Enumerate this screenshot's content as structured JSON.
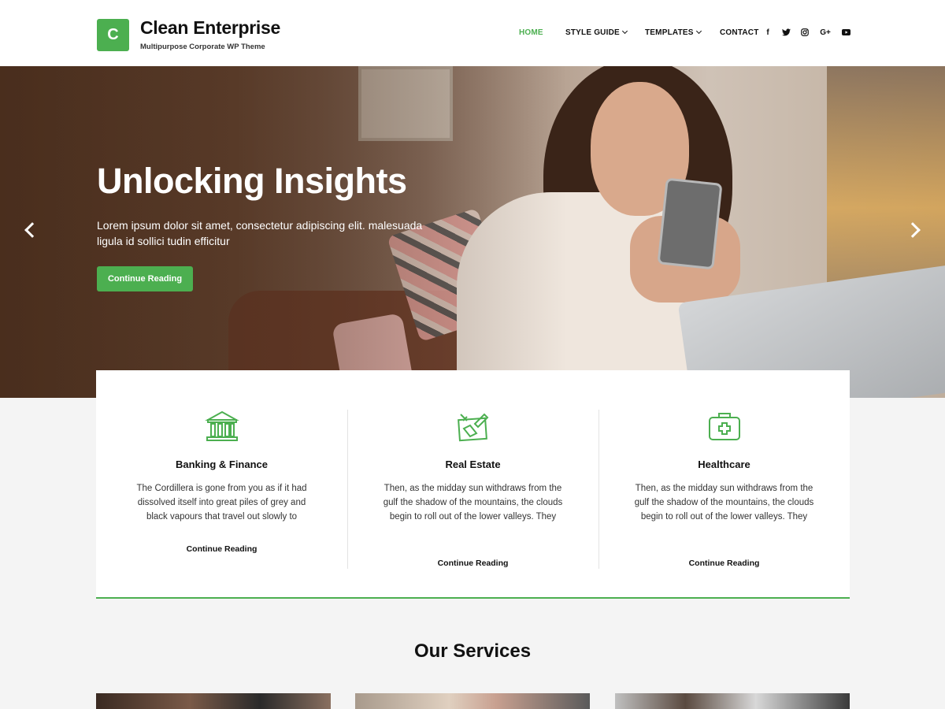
{
  "header": {
    "logo_letter": "C",
    "site_title": "Clean Enterprise",
    "tagline": "Multipurpose Corporate WP Theme",
    "nav": [
      {
        "label": "HOME",
        "active": true
      },
      {
        "label": "STYLE GUIDE",
        "dropdown": true
      },
      {
        "label": "TEMPLATES",
        "dropdown": true
      },
      {
        "label": "CONTACT"
      }
    ],
    "social": [
      {
        "icon": "facebook-icon",
        "glyph": "f"
      },
      {
        "icon": "twitter-icon",
        "glyph": "t"
      },
      {
        "icon": "instagram-icon",
        "glyph": "◎"
      },
      {
        "icon": "google-plus-icon",
        "glyph": "G+"
      },
      {
        "icon": "youtube-icon",
        "glyph": "▶"
      }
    ]
  },
  "hero": {
    "title": "Unlocking Insights",
    "text": "Lorem ipsum dolor sit amet, consectetur adipiscing elit. malesuada ligula id sollici tudin efficitur",
    "button": "Continue Reading"
  },
  "features": [
    {
      "icon": "bank-icon",
      "title": "Banking & Finance",
      "text": "The Cordillera is gone from you as if it had dissolved itself into great piles of grey and black vapours that travel out slowly to",
      "link": "Continue Reading"
    },
    {
      "icon": "real-estate-icon",
      "title": "Real Estate",
      "text": "Then, as the midday sun withdraws from the gulf the shadow of the mountains, the clouds begin to roll out of the lower valleys. They",
      "link": "Continue Reading"
    },
    {
      "icon": "medical-kit-icon",
      "title": "Healthcare",
      "text": "Then, as the midday sun withdraws from the gulf the shadow of the mountains, the clouds begin to roll out of the lower valleys. They",
      "link": "Continue Reading"
    }
  ],
  "services": {
    "title": "Our Services"
  },
  "colors": {
    "accent": "#4caf50"
  }
}
